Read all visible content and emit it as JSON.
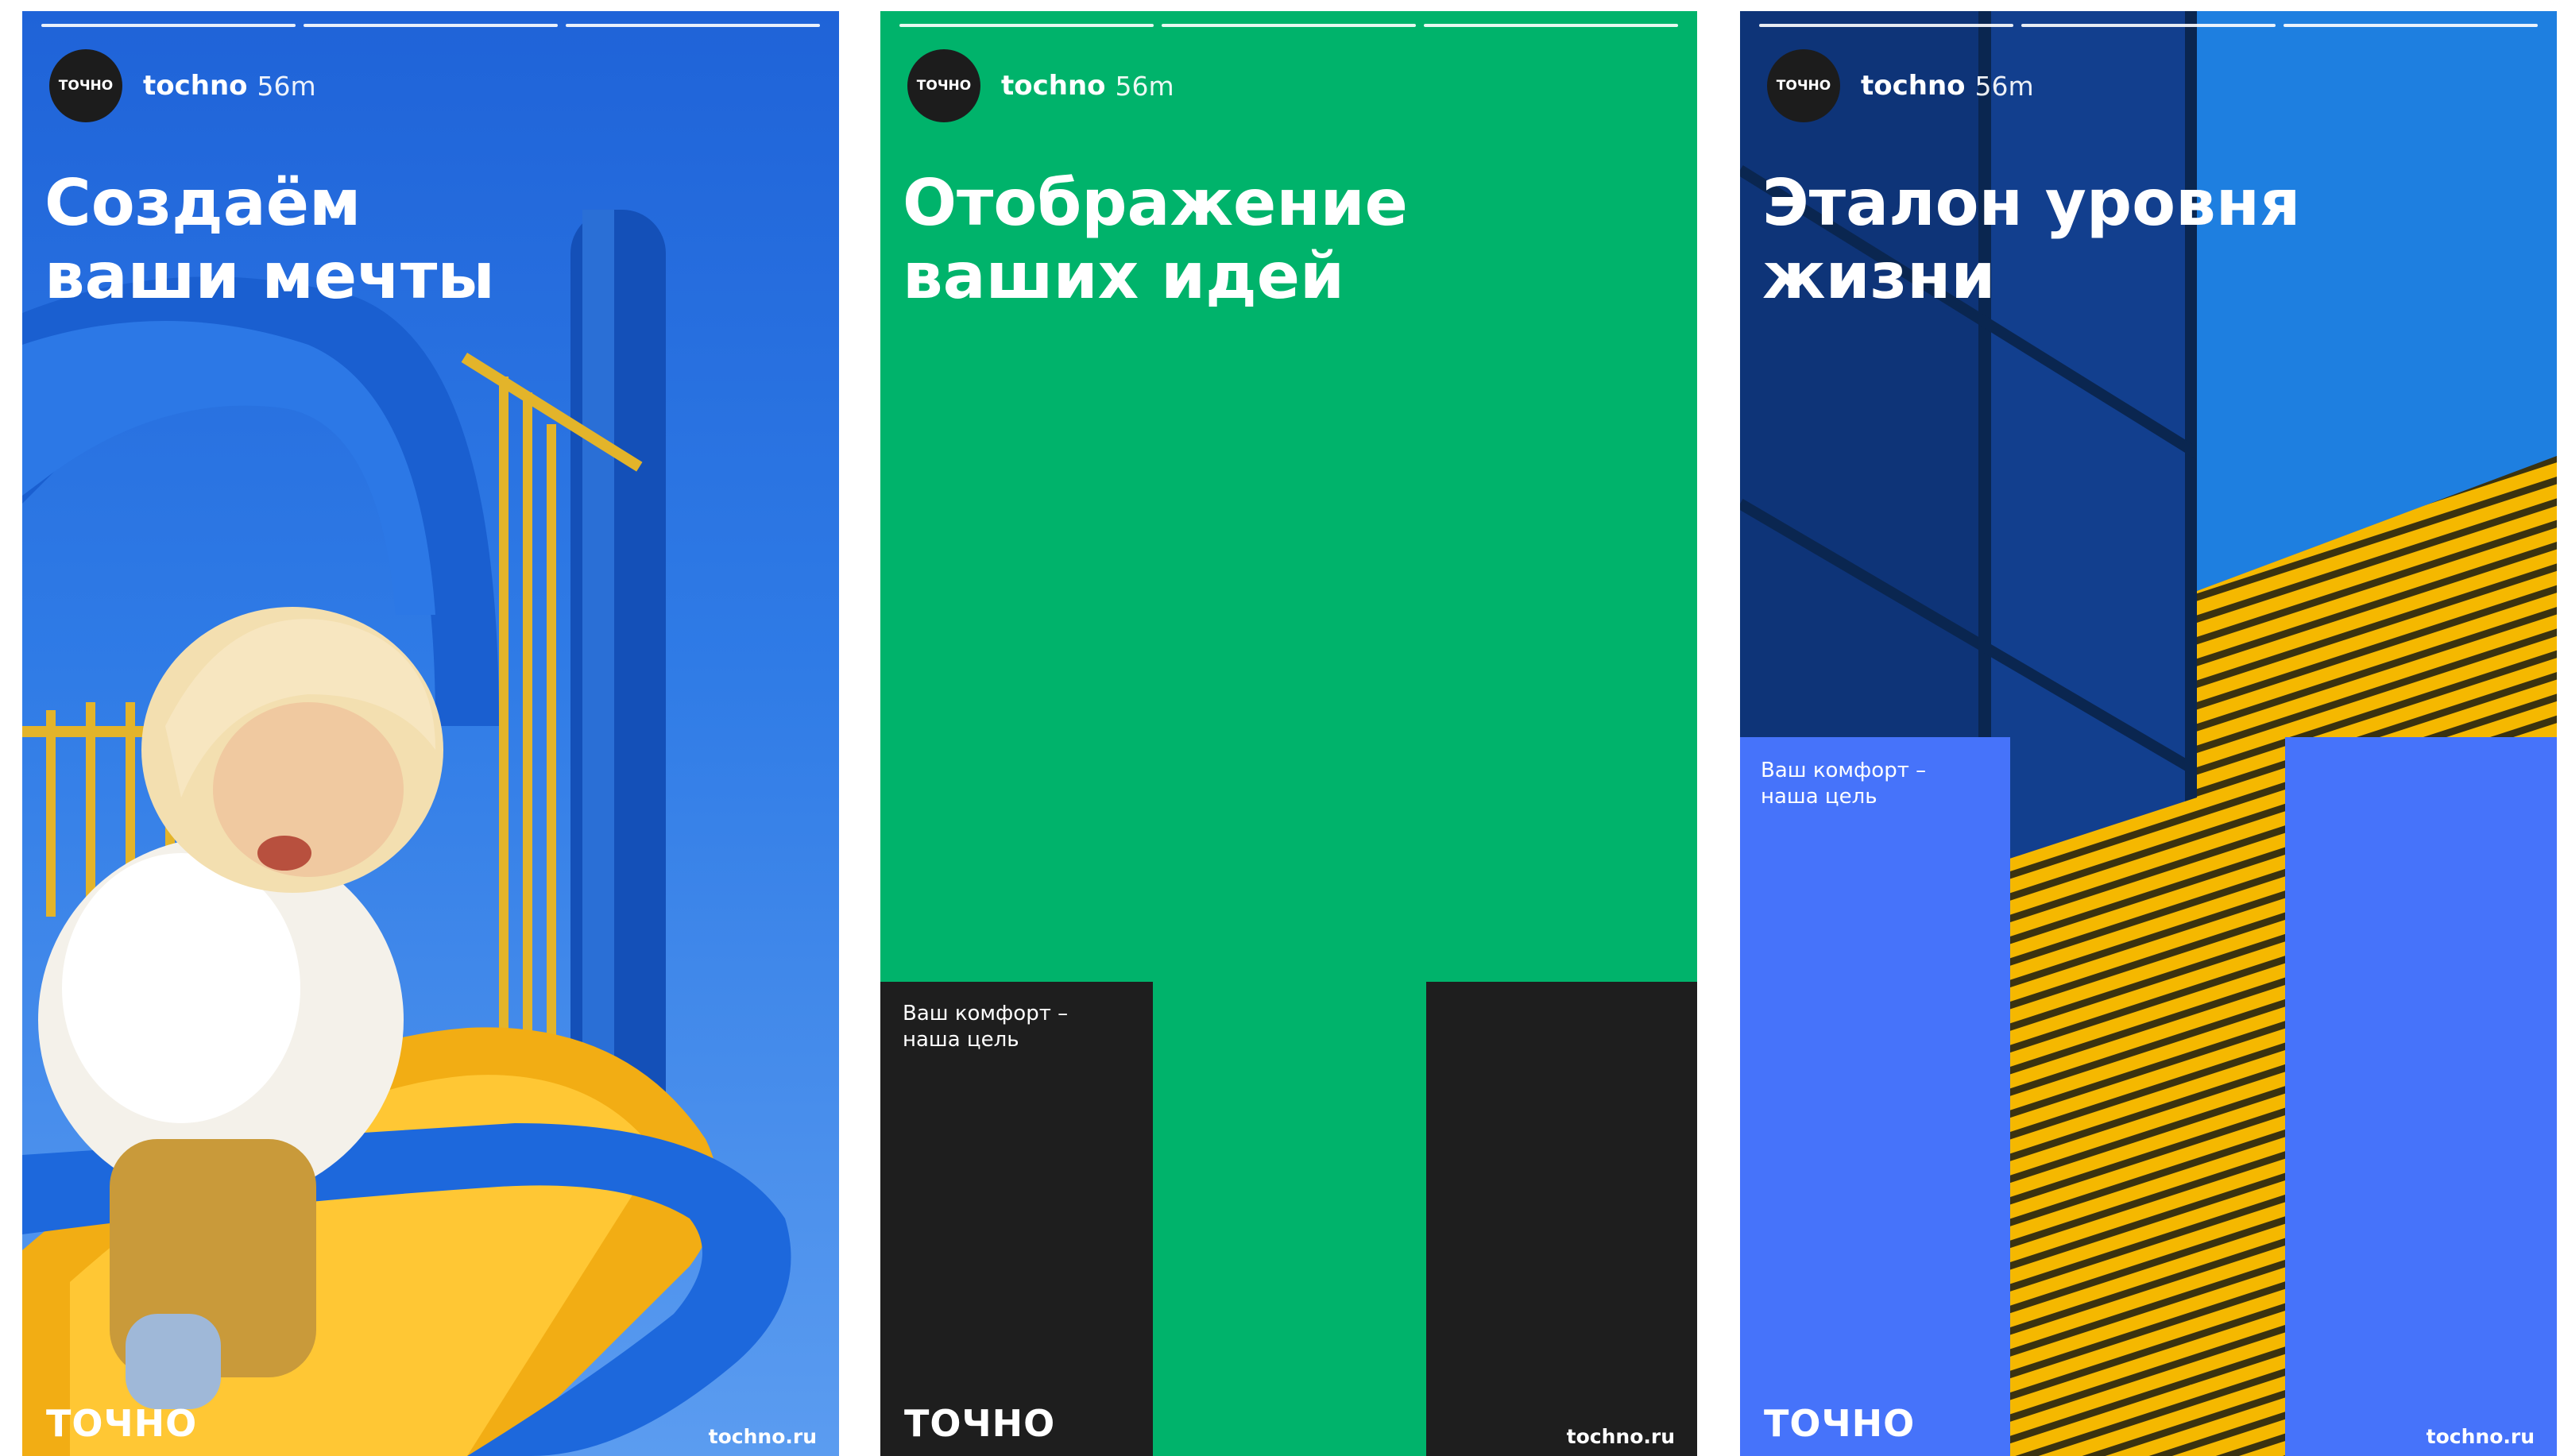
{
  "stories": [
    {
      "avatar_text": "ТОЧНО",
      "account": "tochno",
      "time": "56m",
      "headline": "Создаём\nваши мечты",
      "logo": "ТОЧНО",
      "url": "tochno.ru"
    },
    {
      "avatar_text": "ТОЧНО",
      "account": "tochno",
      "time": "56m",
      "headline": "Отображение\nваших идей",
      "tagline": "Ваш комфорт –\nнаша цель",
      "logo": "ТОЧНО",
      "url": "tochno.ru"
    },
    {
      "avatar_text": "ТОЧНО",
      "account": "tochno",
      "time": "56m",
      "headline": "Эталон уровня\nжизни",
      "tagline": "Ваш комфорт –\nнаша цель",
      "logo": "ТОЧНО",
      "url": "tochno.ru"
    }
  ],
  "colors": {
    "green": "#00b36b",
    "dark": "#1e1e1e",
    "blue": "#4673fa",
    "sky": "#2f7be6",
    "yellow": "#f5b800"
  }
}
